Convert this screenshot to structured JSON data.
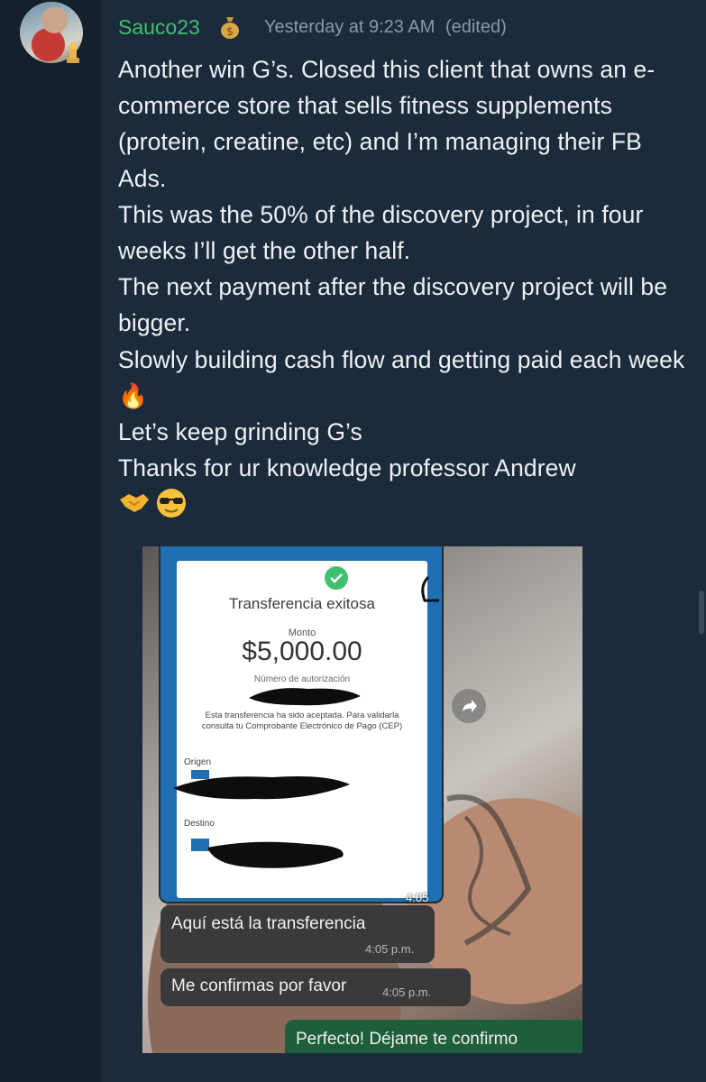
{
  "post": {
    "username": "Sauco23",
    "username_color": "#3fbf6f",
    "timestamp": "Yesterday at 9:23 AM",
    "edited": "(edited)",
    "badge_icon": "money-bag-icon",
    "rank_icon": "rank-badge-icon",
    "message": "Another win G’s. Closed this client that owns an e-commerce store that sells fitness supplements (protein, creatine, etc) and I’m managing their FB Ads.\nThis was the 50% of the discovery project, in four weeks I’ll get the other half.\nThe next payment after the discovery project will be bigger.\nSlowly building cash flow and getting paid each week 🔥\nLet’s keep grinding G’s\nThanks for ur knowledge professor Andrew",
    "emojis": [
      "handshake-emoji",
      "sunglasses-emoji"
    ]
  },
  "attachment": {
    "receipt": {
      "title": "Transferencia exitosa",
      "amount_label": "Monto",
      "amount": "$5,000.00",
      "auth_label": "Número de autorización",
      "accept_text": "Esta transferencia ha sido aceptada. Para validarla consulta tu Comprobante Electrónico de Pago (CEP)",
      "origin_label": "Origen",
      "destination_label": "Destino",
      "image_time": "4:05 p.m."
    },
    "chat": [
      {
        "text": "Aquí está la transferencia",
        "time": "4:05 p.m."
      },
      {
        "text": "Me confirmas por favor",
        "time": "4:05 p.m."
      },
      {
        "text": "Perfecto! Déjame te confirmo"
      }
    ],
    "share_icon": "share-arrow-icon"
  },
  "colors": {
    "background": "#14202e",
    "panel": "#1c2b3c",
    "text": "#eef1f4",
    "timestamp": "#8a97a6"
  }
}
